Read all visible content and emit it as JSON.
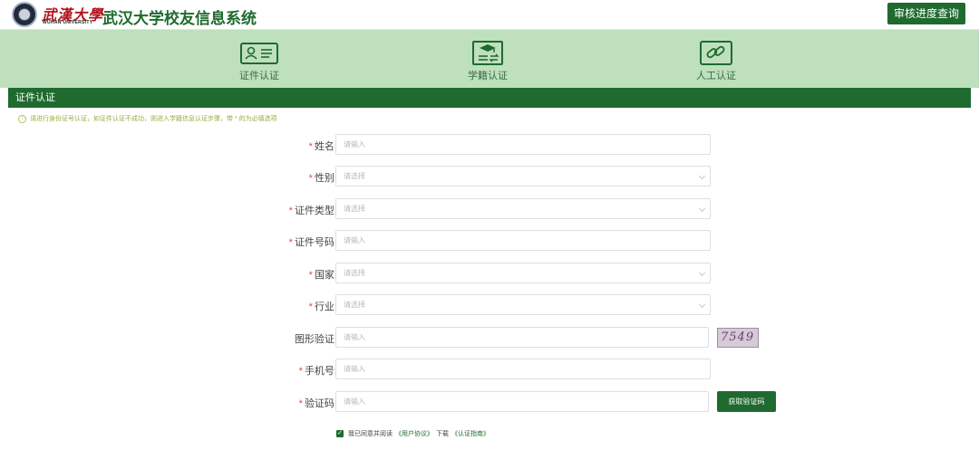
{
  "header": {
    "logo_cn": "武漢大學",
    "logo_en": "WUHAN UNIVERSITY",
    "title": "武汉大学校友信息系统",
    "progress_button": "审核进度查询"
  },
  "steps": [
    {
      "label": "证件认证",
      "icon": "id-card-icon"
    },
    {
      "label": "学籍认证",
      "icon": "graduation-certificate-icon"
    },
    {
      "label": "人工认证",
      "icon": "link-icon"
    }
  ],
  "card": {
    "title": "证件认证",
    "notice": "请进行身份证号认证，如证件认证不成功，则进入学籍信息认证步骤，带 * 的为必填选项"
  },
  "form": {
    "name": {
      "label": "姓名:",
      "required": "*",
      "placeholder": "请输入"
    },
    "gender": {
      "label": "性别:",
      "required": "*",
      "placeholder": "请选择"
    },
    "id_type": {
      "label": "证件类型:",
      "required": "*",
      "placeholder": "请选择"
    },
    "id_number": {
      "label": "证件号码:",
      "required": "*",
      "placeholder": "请输入"
    },
    "country": {
      "label": "国家:",
      "required": "*",
      "placeholder": "请选择"
    },
    "industry": {
      "label": "行业:",
      "required": "*",
      "placeholder": "请选择"
    },
    "captcha": {
      "label": "图形验证:",
      "placeholder": "请输入",
      "image_text": "7549"
    },
    "phone": {
      "label": "手机号:",
      "required": "*",
      "placeholder": "请输入"
    },
    "sms_code": {
      "label": "验证码:",
      "required": "*",
      "placeholder": "请输入",
      "button": "获取验证码"
    }
  },
  "agreement": {
    "checked": true,
    "prefix": "我已同意并阅读",
    "user_agreement": "《用户协议》",
    "download": "下载",
    "guide": "《认证指南》"
  },
  "colors": {
    "brand_green": "#1f6a2e",
    "band_green": "#bee0bd",
    "required_red": "#e04a3a"
  }
}
